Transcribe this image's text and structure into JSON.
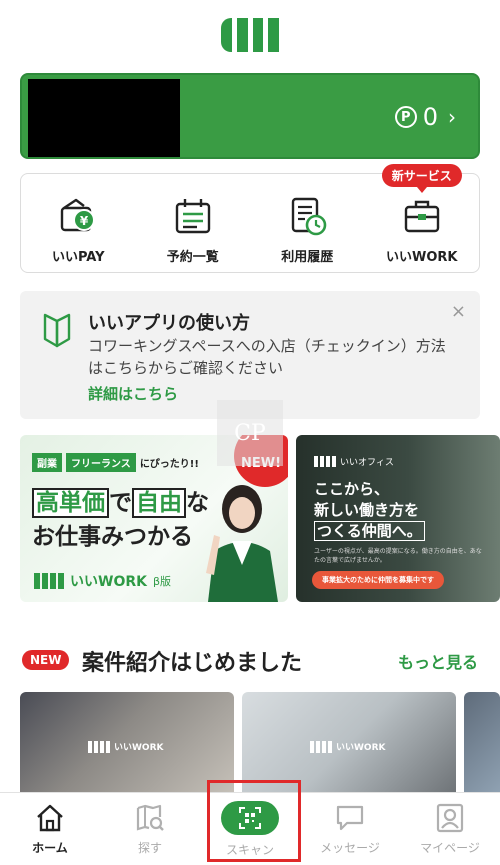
{
  "points": {
    "value": "0",
    "currency_symbol": "P",
    "chevron": "›"
  },
  "services": [
    {
      "label": "いいPAY",
      "icon": "wallet-yen-icon"
    },
    {
      "label": "予約一覧",
      "icon": "calendar-list-icon"
    },
    {
      "label": "利用履歴",
      "icon": "history-document-icon"
    },
    {
      "label": "いいWORK",
      "icon": "briefcase-icon",
      "badge": "新サービス"
    }
  ],
  "guide": {
    "title": "いいアプリの使い方",
    "text": "コワーキングスペースへの入店（チェックイン）方法はこちらからご確認ください",
    "link": "詳細はこちら",
    "close": "×"
  },
  "banners": {
    "work": {
      "tag1": "副業",
      "tag2": "フリーランス",
      "tag_suffix": "にぴったり!!",
      "headline_part1": "高単価",
      "headline_part2": "で",
      "headline_part3": "自由",
      "headline_part4": "な",
      "headline_line2": "お仕事みつかる",
      "brand": "いいWORK",
      "beta": "β版",
      "new_badge": "NEW!"
    },
    "office": {
      "brand": "いいオフィス",
      "line1": "ここから、",
      "line2": "新しい働き方を",
      "line3": "つくる仲間へ。",
      "small": "ユーザーの視点が、最高の提案になる。働き方の自由を、あなたの言葉で広げませんか。",
      "cta": "事業拡大のために仲間を募集中です"
    }
  },
  "cases_section": {
    "new_label": "NEW",
    "title": "案件紹介はじめました",
    "more": "もっと見る",
    "card_brand": "いいWORK"
  },
  "tabbar": [
    {
      "label": "ホーム",
      "icon": "home-icon",
      "active": true
    },
    {
      "label": "探す",
      "icon": "map-search-icon",
      "active": false
    },
    {
      "label": "スキャン",
      "icon": "qr-scan-icon",
      "active": false
    },
    {
      "label": "メッセージ",
      "icon": "message-icon",
      "active": false
    },
    {
      "label": "マイページ",
      "icon": "profile-icon",
      "active": false
    }
  ],
  "watermark": "CP",
  "colors": {
    "brand_green": "#2e9a45",
    "alert_red": "#e0292a"
  }
}
